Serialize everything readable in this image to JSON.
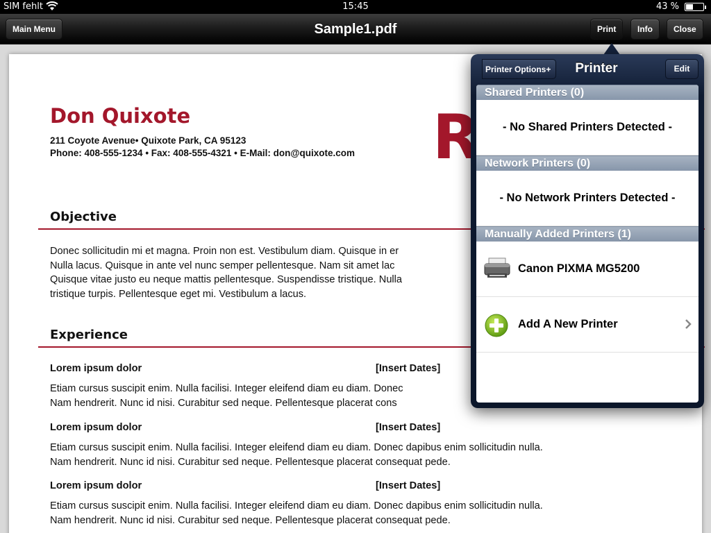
{
  "status_bar": {
    "carrier": "SIM fehlt",
    "time": "15:45",
    "battery": "43 %",
    "battery_level": 0.43
  },
  "navbar": {
    "title": "Sample1.pdf",
    "left_button": "Main Menu",
    "right_buttons": [
      "Print",
      "Info",
      "Close"
    ]
  },
  "document": {
    "name": "Don Quixote",
    "address": "211 Coyote Avenue• Quixote Park, CA 95123",
    "contact": "Phone: 408-555-1234 • Fax: 408-555-4321 • E-Mail: don@quixote.com",
    "cover_letters": "Re",
    "objective": {
      "heading": "Objective",
      "lines": [
        "Donec sollicitudin mi et magna. Proin non est. Vestibulum diam. Quisque in er",
        "Nulla lacus. Quisque in ante vel nunc semper pellentesque. Nam sit amet lac",
        "Quisque vitae justo eu neque mattis pellentesque. Suspendisse tristique. Nulla",
        "tristique turpis. Pellentesque eget mi. Vestibulum a lacus."
      ]
    },
    "experience": {
      "heading": "Experience",
      "jobs": [
        {
          "title": "Lorem ipsum dolor",
          "dates": "[Insert Dates]",
          "lines": [
            "Etiam cursus suscipit enim. Nulla facilisi. Integer eleifend diam eu diam. Donec",
            "Nam hendrerit. Nunc id nisi. Curabitur sed neque. Pellentesque placerat cons"
          ]
        },
        {
          "title": "Lorem ipsum dolor",
          "dates": "[Insert Dates]",
          "lines": [
            "Etiam cursus suscipit enim. Nulla facilisi. Integer eleifend diam eu diam. Donec dapibus enim sollicitudin nulla.",
            "Nam hendrerit. Nunc id nisi. Curabitur sed neque. Pellentesque placerat consequat pede."
          ]
        },
        {
          "title": "Lorem ipsum dolor",
          "dates": "[Insert Dates]",
          "lines": [
            "Etiam cursus suscipit enim. Nulla facilisi. Integer eleifend diam eu diam. Donec dapibus enim sollicitudin nulla.",
            "Nam hendrerit. Nunc id nisi. Curabitur sed neque. Pellentesque placerat consequat pede."
          ]
        }
      ]
    }
  },
  "popover": {
    "back_button": "Printer Options+",
    "title": "Printer",
    "edit_button": "Edit",
    "sections": [
      {
        "header": "Shared Printers (0)",
        "empty_text": "- No Shared Printers Detected -"
      },
      {
        "header": "Network Printers (0)",
        "empty_text": "- No Network Printers Detected -"
      },
      {
        "header": "Manually Added Printers (1)",
        "printer": "Canon PIXMA MG5200",
        "add_label": "Add A New Printer"
      }
    ],
    "icons": [
      "printer-icon",
      "add-circle-icon",
      "chevron-right-icon"
    ]
  },
  "colors": {
    "accent_red": "#a3172b",
    "section_header": "#8796aa",
    "popover_navy": "#0e1a30"
  }
}
